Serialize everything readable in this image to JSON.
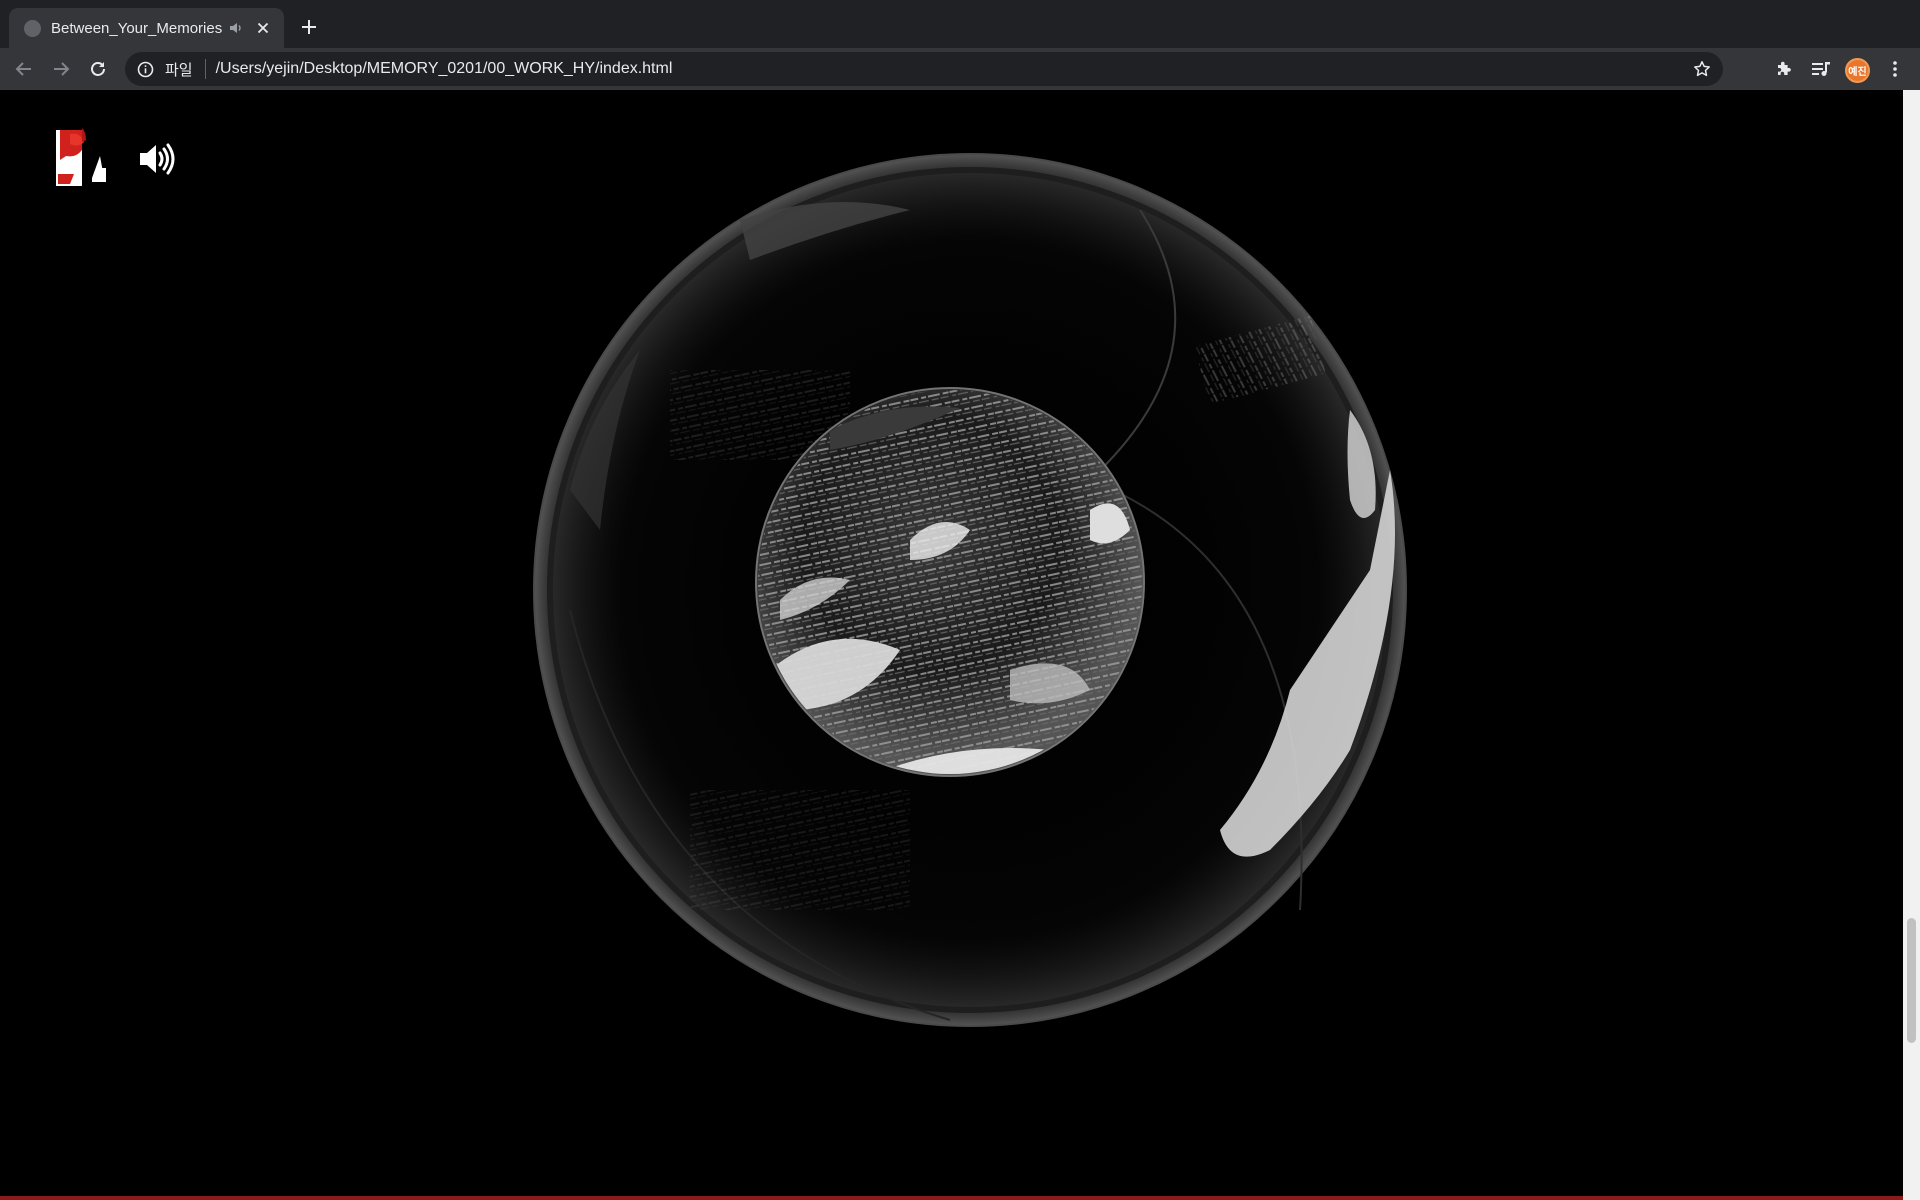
{
  "browser": {
    "tab": {
      "title": "Between_Your_Memories",
      "audio_icon": "speaker-icon",
      "close_icon": "close-icon"
    },
    "new_tab_icon": "plus-icon",
    "nav": {
      "back_icon": "arrow-left-icon",
      "forward_icon": "arrow-right-icon",
      "reload_icon": "reload-icon"
    },
    "omnibox": {
      "info_icon": "info-icon",
      "scheme_label": "파일",
      "url": "/Users/yejin/Desktop/MEMORY_0201/00_WORK_HY/index.html",
      "bookmark_icon": "star-icon"
    },
    "toolbar_icons": [
      "extensions-puzzle-icon",
      "media-queue-icon",
      "more-vert-icon"
    ],
    "profile": {
      "label": "예진",
      "color": "#e8762d"
    }
  },
  "page": {
    "background": "#000000",
    "logo": "red-white-logo",
    "sound_button_icon": "speaker-volume-icon",
    "visual": "glass-sphere-with-text-inner-sphere"
  }
}
